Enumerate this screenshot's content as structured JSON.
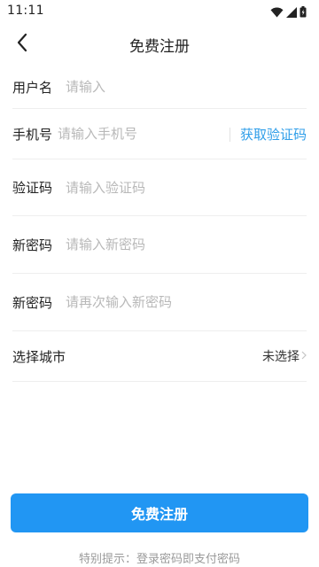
{
  "status_bar": {
    "time": "11:11",
    "icons": [
      "wifi-icon",
      "signal-icon",
      "battery-icon"
    ]
  },
  "header": {
    "back_icon": "chevron-left-icon",
    "title": "免费注册"
  },
  "form": {
    "username": {
      "label": "用户名",
      "placeholder": "请输入"
    },
    "phone": {
      "label": "手机号",
      "placeholder": "请输入手机号",
      "code_button": "获取验证码"
    },
    "code": {
      "label": "验证码",
      "placeholder": "请输入验证码"
    },
    "password": {
      "label": "新密码",
      "placeholder": "请输入新密码"
    },
    "confirm_password": {
      "label": "新密码",
      "placeholder": "请再次输入新密码"
    },
    "city": {
      "label": "选择城市",
      "value": "未选择",
      "arrow_icon": "chevron-right-icon"
    }
  },
  "submit": {
    "label": "免费注册"
  },
  "tip": "特别提示：登录密码即支付密码",
  "colors": {
    "accent": "#2196f3",
    "link": "#2f9ee9",
    "placeholder": "#b8b8b8",
    "divider": "#eeeeee"
  }
}
